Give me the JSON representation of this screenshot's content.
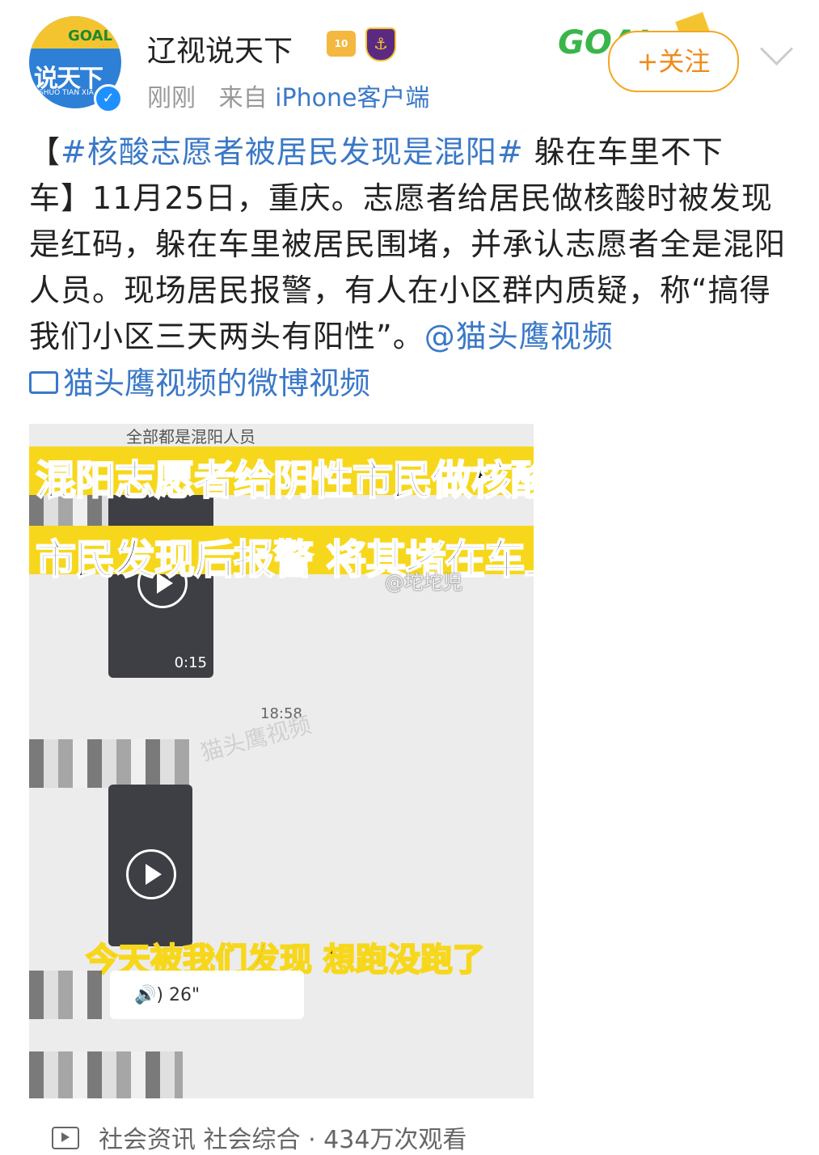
{
  "header": {
    "avatar_text": "说天下",
    "avatar_sub": "SHUO TIAN XIA",
    "avatar_goal": "GOAL",
    "username": "辽视说天下",
    "badge_shirt": "10",
    "time": "刚刚",
    "source_prefix": "来自",
    "source": "iPhone客户端",
    "goal_deco": "GOAL",
    "follow_label": "+关注"
  },
  "post": {
    "bracket_open": "【",
    "hashtag": "#核酸志愿者被居民发现是混阳#",
    "headline": " 躲在车里不下车",
    "bracket_close": "】",
    "body": "11月25日，重庆。志愿者给居民做核酸时被发现是红码，躲在车里被居民围堵，并承认志愿者全是混阳人员。现场居民报警，有人在小区群内质疑，称“搞得我们小区三天两头有阳性”。",
    "mention": "@猫头鹰视频",
    "video_link": "猫头鹰视频的微博视频"
  },
  "video": {
    "top_caption": "全部都是混阳人员",
    "banner1": "混阳志愿者给阴性市民做核酸",
    "banner2": "市民发现后报警 将其堵在车上",
    "thumb1_duration": "0:15",
    "timestamp": "18:58",
    "watermark": "猫头鹰视频",
    "bottom_caption": "今天被我们发现 想跑没跑了",
    "voice": "🔊) 26\"",
    "weibo_watermark": "@坨坨児"
  },
  "footer": {
    "category": "社会资讯 社会综合 · 434万次观看"
  },
  "colors": {
    "link": "#3a78c8",
    "follow": "#f08a1c",
    "banner": "#f7d71c"
  }
}
